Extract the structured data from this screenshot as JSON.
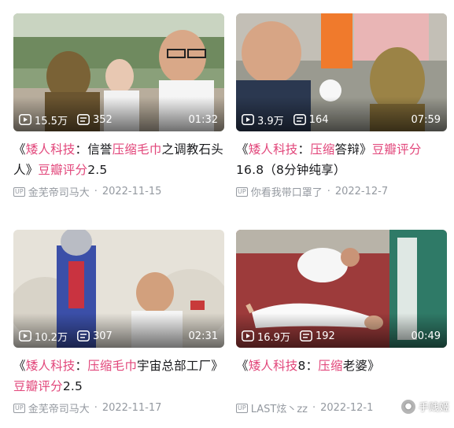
{
  "cards": [
    {
      "views": "15.5万",
      "danmaku": "352",
      "duration": "01:32",
      "title_parts": [
        "《",
        "矮人科技",
        "：信誉",
        "压缩毛巾",
        "之调教石头人》",
        "豆瓣评分",
        "2.5"
      ],
      "uploader": "金芜帝司马大",
      "date": "2022-11-15",
      "up_badge": "UP"
    },
    {
      "views": "3.9万",
      "danmaku": "164",
      "duration": "07:59",
      "title_parts": [
        "《",
        "矮人科技",
        "：",
        "压缩",
        "答辩》",
        "豆瓣评分",
        "16.8（8分钟纯享）"
      ],
      "uploader": "你看我带口罩了",
      "date": "2022-12-7",
      "up_badge": "UP"
    },
    {
      "views": "10.2万",
      "danmaku": "307",
      "duration": "02:31",
      "title_parts": [
        "《",
        "矮人科技",
        "：",
        "压缩毛巾",
        "宇宙总部工厂》",
        "豆瓣评分",
        "2.5"
      ],
      "uploader": "金芜帝司马大",
      "date": "2022-11-17",
      "up_badge": "UP"
    },
    {
      "views": "16.9万",
      "danmaku": "192",
      "duration": "00:49",
      "title_parts": [
        "《",
        "矮人科技",
        "8：",
        "压缩",
        "老婆》",
        "",
        ""
      ],
      "uploader": "LAST炫丶zz",
      "date": "2022-12-1",
      "up_badge": "UP"
    }
  ],
  "watermark": {
    "text": "手贱姬"
  },
  "icons": {
    "views": "play-count-icon",
    "danmaku": "danmaku-icon"
  },
  "colors": {
    "highlight": "#e2477b",
    "meta": "#9499a0"
  }
}
